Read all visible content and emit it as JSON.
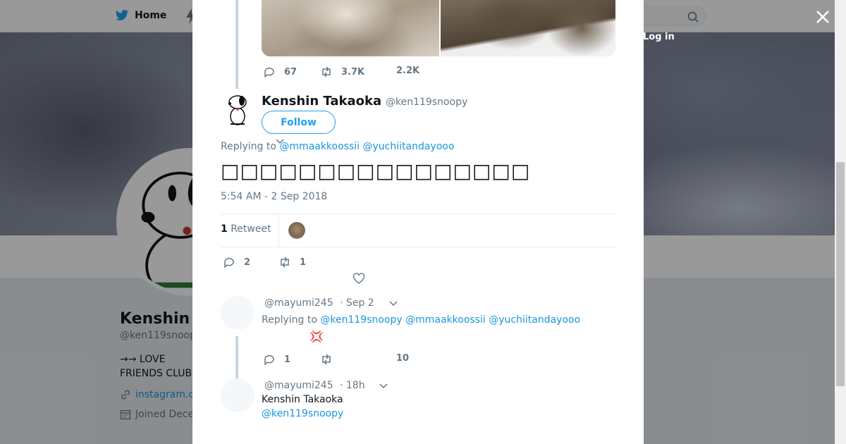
{
  "nav": {
    "home_label": "Home",
    "login_label": "Log in"
  },
  "background_profile": {
    "name": "Kenshin T",
    "handle": "@ken119snoop",
    "bio_line1": "→→  LOVE",
    "bio_line2": "FRIENDS CLUB",
    "link": "instagram.c",
    "joined": "Joined Dece"
  },
  "parent_tweet": {
    "actions": {
      "reply_count": "67",
      "retweet_count": "3.7K",
      "like_count": "2.2K"
    }
  },
  "main_tweet": {
    "name": "Kenshin Takaoka",
    "handle": "@ken119snoopy",
    "follow_label": "Follow",
    "replying_prefix": "Replying to",
    "replying_to": [
      "@mmaakkoossii",
      "@yuchiitandayooo"
    ],
    "text": "□□□□□□□□□□□□□□□□",
    "timestamp": "5:54 AM - 2 Sep 2018",
    "retweet_stat_count": "1",
    "retweet_stat_label": "Retweet",
    "actions": {
      "reply_count": "2",
      "retweet_count": "1"
    }
  },
  "replies": [
    {
      "handle": "@mayumi245",
      "time": "· Sep 2",
      "replying_prefix": "Replying to",
      "replying_to": [
        "@ken119snoopy",
        "@mmaakkoossii",
        "@yuchiitandayooo"
      ],
      "emoji": "💢",
      "actions": {
        "reply_count": "1",
        "like_count": "10"
      }
    },
    {
      "handle": "@mayumi245",
      "time": "· 18h",
      "line1": "Kenshin Takaoka",
      "line2": "@ken119snoopy"
    }
  ],
  "colors": {
    "accent": "#1da1f2",
    "link": "#1b95e0",
    "muted": "#657786"
  }
}
